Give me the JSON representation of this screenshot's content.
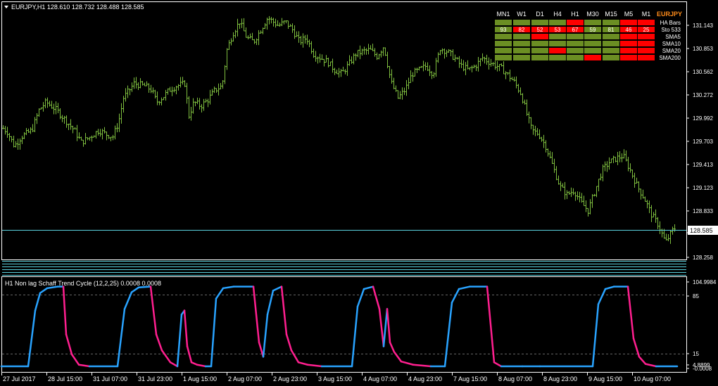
{
  "header": {
    "symbol_line": "EURJPY,H1  128.610 128.732 128.488 128.585",
    "indicator_line": "H1 Non lag Schaff Trend Cycle  (12,2,25) 0.0008 0.0008"
  },
  "colors": {
    "background": "#000000",
    "bars": "#7fbf3f",
    "axis": "#ffffff",
    "price_line": "#5bd3e0",
    "stc_up": "#29a3ff",
    "stc_down": "#ff1f8f",
    "table_green": "#6b8e23",
    "table_red": "#ff0000",
    "symbol": "#ff8c1a"
  },
  "price_axis": {
    "ticks": [
      "131.143",
      "130.853",
      "130.562",
      "130.272",
      "129.992",
      "129.703",
      "129.413",
      "129.123",
      "128.833",
      "128.543",
      "128.258"
    ],
    "current": "128.585"
  },
  "indicator_axis": {
    "ticks": [
      "104.9984",
      "85",
      "15",
      "4.8899",
      "-0.0008"
    ]
  },
  "time_axis": {
    "labels": [
      "27 Jul 2017",
      "28 Jul 15:00",
      "31 Jul 07:00",
      "31 Jul 23:00",
      "1 Aug 15:00",
      "2 Aug 07:00",
      "2 Aug 23:00",
      "3 Aug 15:00",
      "4 Aug 07:00",
      "4 Aug 23:00",
      "7 Aug 15:00",
      "8 Aug 07:00",
      "8 Aug 23:00",
      "9 Aug 15:00",
      "10 Aug 07:00"
    ]
  },
  "dashboard": {
    "symbol": "EURJPY",
    "timeframes": [
      "MN1",
      "W1",
      "D1",
      "H4",
      "H1",
      "M30",
      "M15",
      "M5",
      "M1"
    ],
    "rows": [
      {
        "label": "HA Bars",
        "cells": [
          "g",
          "g",
          "g",
          "g",
          "r",
          "g",
          "g",
          "r",
          "r"
        ],
        "values": [
          "",
          "",
          "",
          "",
          "",
          "",
          "",
          "",
          ""
        ]
      },
      {
        "label": "Sto 533",
        "cells": [
          "g",
          "r",
          "r",
          "r",
          "r",
          "g",
          "g",
          "r",
          "r"
        ],
        "values": [
          "93",
          "82",
          "52",
          "53",
          "67",
          "59",
          "81",
          "46",
          "25"
        ]
      },
      {
        "label": "SMA5",
        "cells": [
          "g",
          "g",
          "r",
          "g",
          "g",
          "g",
          "g",
          "r",
          "r"
        ],
        "values": [
          "",
          "",
          "",
          "",
          "",
          "",
          "",
          "",
          ""
        ]
      },
      {
        "label": "SMA10",
        "cells": [
          "g",
          "g",
          "g",
          "g",
          "g",
          "g",
          "g",
          "r",
          "r"
        ],
        "values": [
          "",
          "",
          "",
          "",
          "",
          "",
          "",
          "",
          ""
        ]
      },
      {
        "label": "SMA20",
        "cells": [
          "g",
          "g",
          "g",
          "r",
          "g",
          "g",
          "g",
          "r",
          "r"
        ],
        "values": [
          "",
          "",
          "",
          "",
          "",
          "",
          "",
          "",
          ""
        ]
      },
      {
        "label": "SMA200",
        "cells": [
          "g",
          "g",
          "g",
          "g",
          "g",
          "r",
          "g",
          "r",
          "r"
        ],
        "values": [
          "",
          "",
          "",
          "",
          "",
          "",
          "",
          "",
          ""
        ]
      }
    ]
  },
  "chart_data": [
    {
      "type": "ohlc",
      "title": "EURJPY,H1",
      "ylim": [
        128.2,
        131.35
      ],
      "close_path": [
        [
          0,
          129.85
        ],
        [
          10,
          129.78
        ],
        [
          20,
          129.6
        ],
        [
          30,
          129.72
        ],
        [
          45,
          129.8
        ],
        [
          55,
          130.05
        ],
        [
          65,
          130.15
        ],
        [
          80,
          130.05
        ],
        [
          95,
          129.9
        ],
        [
          105,
          129.8
        ],
        [
          115,
          129.65
        ],
        [
          125,
          129.7
        ],
        [
          140,
          129.8
        ],
        [
          150,
          129.75
        ],
        [
          160,
          129.72
        ],
        [
          168,
          129.9
        ],
        [
          175,
          130.2
        ],
        [
          190,
          130.38
        ],
        [
          205,
          130.35
        ],
        [
          215,
          130.3
        ],
        [
          222,
          130.15
        ],
        [
          232,
          130.22
        ],
        [
          240,
          130.3
        ],
        [
          250,
          130.35
        ],
        [
          262,
          130.38
        ],
        [
          268,
          129.98
        ],
        [
          275,
          130.15
        ],
        [
          285,
          130.1
        ],
        [
          295,
          130.18
        ],
        [
          305,
          130.3
        ],
        [
          315,
          130.35
        ],
        [
          322,
          130.8
        ],
        [
          330,
          131.0
        ],
        [
          340,
          131.15
        ],
        [
          350,
          130.95
        ],
        [
          360,
          130.9
        ],
        [
          370,
          131.05
        ],
        [
          380,
          131.2
        ],
        [
          395,
          131.1
        ],
        [
          405,
          131.15
        ],
        [
          415,
          131.05
        ],
        [
          425,
          130.9
        ],
        [
          435,
          130.95
        ],
        [
          445,
          130.75
        ],
        [
          455,
          130.7
        ],
        [
          465,
          130.65
        ],
        [
          475,
          130.55
        ],
        [
          485,
          130.5
        ],
        [
          495,
          130.62
        ],
        [
          505,
          130.75
        ],
        [
          515,
          130.78
        ],
        [
          525,
          130.8
        ],
        [
          535,
          130.72
        ],
        [
          545,
          130.85
        ],
        [
          555,
          130.4
        ],
        [
          565,
          130.2
        ],
        [
          575,
          130.3
        ],
        [
          585,
          130.5
        ],
        [
          595,
          130.55
        ],
        [
          605,
          130.6
        ],
        [
          615,
          130.5
        ],
        [
          625,
          130.82
        ],
        [
          635,
          130.78
        ],
        [
          645,
          130.7
        ],
        [
          655,
          130.6
        ],
        [
          665,
          130.55
        ],
        [
          675,
          130.6
        ],
        [
          685,
          130.7
        ],
        [
          700,
          130.62
        ],
        [
          710,
          130.58
        ],
        [
          720,
          130.5
        ],
        [
          730,
          130.4
        ],
        [
          740,
          130.25
        ],
        [
          748,
          130.0
        ],
        [
          755,
          129.8
        ],
        [
          765,
          129.75
        ],
        [
          775,
          129.6
        ],
        [
          785,
          129.35
        ],
        [
          795,
          129.1
        ],
        [
          805,
          129.0
        ],
        [
          815,
          129.05
        ],
        [
          825,
          128.9
        ],
        [
          835,
          128.8
        ],
        [
          845,
          129.05
        ],
        [
          855,
          129.3
        ],
        [
          865,
          129.4
        ],
        [
          875,
          129.45
        ],
        [
          885,
          129.48
        ],
        [
          895,
          129.3
        ],
        [
          905,
          129.1
        ],
        [
          915,
          128.95
        ],
        [
          925,
          128.75
        ],
        [
          935,
          128.62
        ],
        [
          945,
          128.4
        ],
        [
          955,
          128.55
        ],
        [
          960,
          128.6
        ]
      ]
    },
    {
      "type": "line",
      "title": "H1 Non lag Schaff Trend Cycle",
      "ylim": [
        -0.0008,
        104.9984
      ],
      "levels": [
        15,
        85
      ],
      "series": [
        {
          "name": "STC",
          "points": [
            [
              0,
              0
            ],
            [
              38,
              0
            ],
            [
              48,
              70
            ],
            [
              55,
              92
            ],
            [
              65,
              98
            ],
            [
              80,
              100
            ],
            [
              88,
              100
            ],
            [
              92,
              40
            ],
            [
              100,
              15
            ],
            [
              110,
              2
            ],
            [
              125,
              0
            ],
            [
              165,
              0
            ],
            [
              175,
              72
            ],
            [
              185,
              93
            ],
            [
              195,
              99
            ],
            [
              212,
              100
            ],
            [
              220,
              40
            ],
            [
              228,
              20
            ],
            [
              240,
              5
            ],
            [
              250,
              0
            ],
            [
              256,
              65
            ],
            [
              260,
              70
            ],
            [
              264,
              25
            ],
            [
              270,
              5
            ],
            [
              278,
              2
            ],
            [
              290,
              0
            ],
            [
              298,
              0
            ],
            [
              305,
              85
            ],
            [
              315,
              98
            ],
            [
              330,
              100
            ],
            [
              358,
              100
            ],
            [
              366,
              30
            ],
            [
              372,
              12
            ],
            [
              378,
              65
            ],
            [
              386,
              95
            ],
            [
              398,
              100
            ],
            [
              405,
              40
            ],
            [
              412,
              20
            ],
            [
              422,
              5
            ],
            [
              435,
              2
            ],
            [
              455,
              0
            ],
            [
              498,
              0
            ],
            [
              506,
              75
            ],
            [
              515,
              97
            ],
            [
              528,
              100
            ],
            [
              537,
              72
            ],
            [
              543,
              25
            ],
            [
              548,
              72
            ],
            [
              552,
              30
            ],
            [
              558,
              18
            ],
            [
              568,
              6
            ],
            [
              585,
              2
            ],
            [
              610,
              0
            ],
            [
              630,
              0
            ],
            [
              640,
              80
            ],
            [
              650,
              97
            ],
            [
              665,
              100
            ],
            [
              690,
              100
            ],
            [
              700,
              5
            ],
            [
              710,
              0
            ],
            [
              740,
              0
            ],
            [
              765,
              0
            ],
            [
              840,
              0
            ],
            [
              848,
              78
            ],
            [
              858,
              97
            ],
            [
              870,
              100
            ],
            [
              890,
              100
            ],
            [
              898,
              35
            ],
            [
              906,
              12
            ],
            [
              915,
              3
            ],
            [
              930,
              0
            ],
            [
              960,
              0
            ]
          ]
        }
      ]
    }
  ]
}
